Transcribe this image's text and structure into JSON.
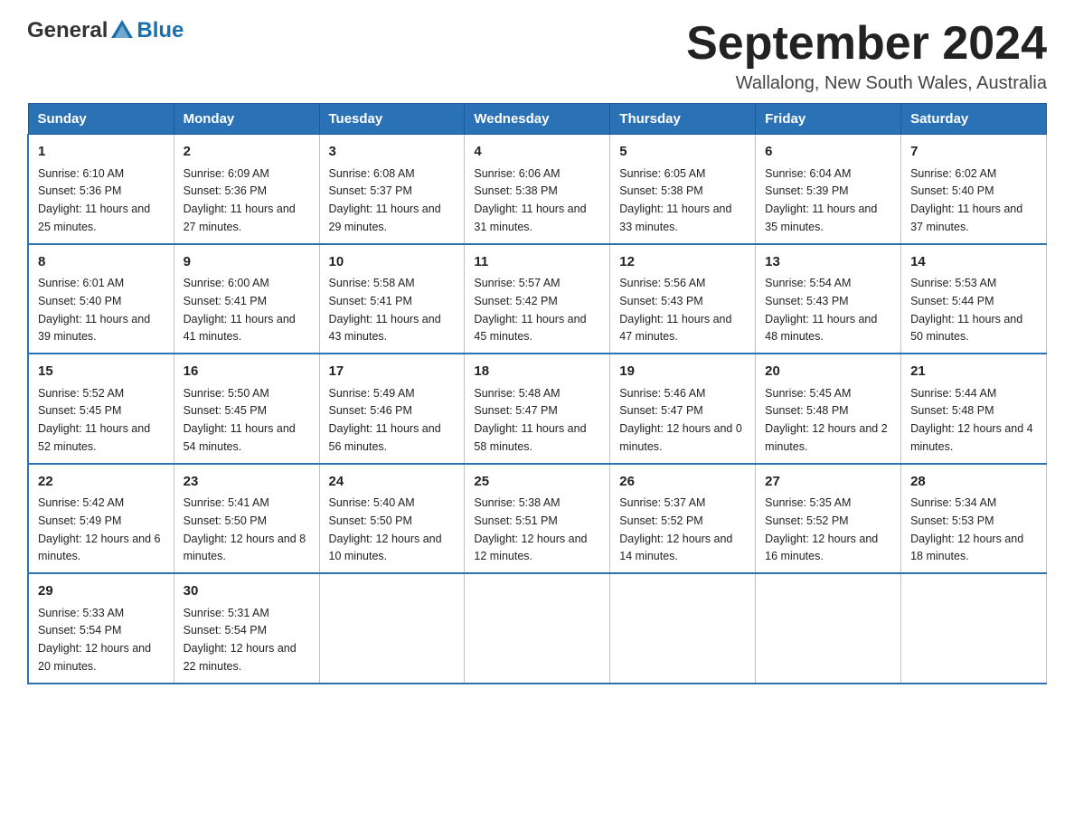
{
  "header": {
    "logo_general": "General",
    "logo_blue": "Blue",
    "month_title": "September 2024",
    "subtitle": "Wallalong, New South Wales, Australia"
  },
  "days_of_week": [
    "Sunday",
    "Monday",
    "Tuesday",
    "Wednesday",
    "Thursday",
    "Friday",
    "Saturday"
  ],
  "weeks": [
    [
      {
        "day": "1",
        "sunrise": "6:10 AM",
        "sunset": "5:36 PM",
        "daylight": "11 hours and 25 minutes."
      },
      {
        "day": "2",
        "sunrise": "6:09 AM",
        "sunset": "5:36 PM",
        "daylight": "11 hours and 27 minutes."
      },
      {
        "day": "3",
        "sunrise": "6:08 AM",
        "sunset": "5:37 PM",
        "daylight": "11 hours and 29 minutes."
      },
      {
        "day": "4",
        "sunrise": "6:06 AM",
        "sunset": "5:38 PM",
        "daylight": "11 hours and 31 minutes."
      },
      {
        "day": "5",
        "sunrise": "6:05 AM",
        "sunset": "5:38 PM",
        "daylight": "11 hours and 33 minutes."
      },
      {
        "day": "6",
        "sunrise": "6:04 AM",
        "sunset": "5:39 PM",
        "daylight": "11 hours and 35 minutes."
      },
      {
        "day": "7",
        "sunrise": "6:02 AM",
        "sunset": "5:40 PM",
        "daylight": "11 hours and 37 minutes."
      }
    ],
    [
      {
        "day": "8",
        "sunrise": "6:01 AM",
        "sunset": "5:40 PM",
        "daylight": "11 hours and 39 minutes."
      },
      {
        "day": "9",
        "sunrise": "6:00 AM",
        "sunset": "5:41 PM",
        "daylight": "11 hours and 41 minutes."
      },
      {
        "day": "10",
        "sunrise": "5:58 AM",
        "sunset": "5:41 PM",
        "daylight": "11 hours and 43 minutes."
      },
      {
        "day": "11",
        "sunrise": "5:57 AM",
        "sunset": "5:42 PM",
        "daylight": "11 hours and 45 minutes."
      },
      {
        "day": "12",
        "sunrise": "5:56 AM",
        "sunset": "5:43 PM",
        "daylight": "11 hours and 47 minutes."
      },
      {
        "day": "13",
        "sunrise": "5:54 AM",
        "sunset": "5:43 PM",
        "daylight": "11 hours and 48 minutes."
      },
      {
        "day": "14",
        "sunrise": "5:53 AM",
        "sunset": "5:44 PM",
        "daylight": "11 hours and 50 minutes."
      }
    ],
    [
      {
        "day": "15",
        "sunrise": "5:52 AM",
        "sunset": "5:45 PM",
        "daylight": "11 hours and 52 minutes."
      },
      {
        "day": "16",
        "sunrise": "5:50 AM",
        "sunset": "5:45 PM",
        "daylight": "11 hours and 54 minutes."
      },
      {
        "day": "17",
        "sunrise": "5:49 AM",
        "sunset": "5:46 PM",
        "daylight": "11 hours and 56 minutes."
      },
      {
        "day": "18",
        "sunrise": "5:48 AM",
        "sunset": "5:47 PM",
        "daylight": "11 hours and 58 minutes."
      },
      {
        "day": "19",
        "sunrise": "5:46 AM",
        "sunset": "5:47 PM",
        "daylight": "12 hours and 0 minutes."
      },
      {
        "day": "20",
        "sunrise": "5:45 AM",
        "sunset": "5:48 PM",
        "daylight": "12 hours and 2 minutes."
      },
      {
        "day": "21",
        "sunrise": "5:44 AM",
        "sunset": "5:48 PM",
        "daylight": "12 hours and 4 minutes."
      }
    ],
    [
      {
        "day": "22",
        "sunrise": "5:42 AM",
        "sunset": "5:49 PM",
        "daylight": "12 hours and 6 minutes."
      },
      {
        "day": "23",
        "sunrise": "5:41 AM",
        "sunset": "5:50 PM",
        "daylight": "12 hours and 8 minutes."
      },
      {
        "day": "24",
        "sunrise": "5:40 AM",
        "sunset": "5:50 PM",
        "daylight": "12 hours and 10 minutes."
      },
      {
        "day": "25",
        "sunrise": "5:38 AM",
        "sunset": "5:51 PM",
        "daylight": "12 hours and 12 minutes."
      },
      {
        "day": "26",
        "sunrise": "5:37 AM",
        "sunset": "5:52 PM",
        "daylight": "12 hours and 14 minutes."
      },
      {
        "day": "27",
        "sunrise": "5:35 AM",
        "sunset": "5:52 PM",
        "daylight": "12 hours and 16 minutes."
      },
      {
        "day": "28",
        "sunrise": "5:34 AM",
        "sunset": "5:53 PM",
        "daylight": "12 hours and 18 minutes."
      }
    ],
    [
      {
        "day": "29",
        "sunrise": "5:33 AM",
        "sunset": "5:54 PM",
        "daylight": "12 hours and 20 minutes."
      },
      {
        "day": "30",
        "sunrise": "5:31 AM",
        "sunset": "5:54 PM",
        "daylight": "12 hours and 22 minutes."
      },
      null,
      null,
      null,
      null,
      null
    ]
  ],
  "labels": {
    "sunrise_prefix": "Sunrise: ",
    "sunset_prefix": "Sunset: ",
    "daylight_prefix": "Daylight: "
  }
}
